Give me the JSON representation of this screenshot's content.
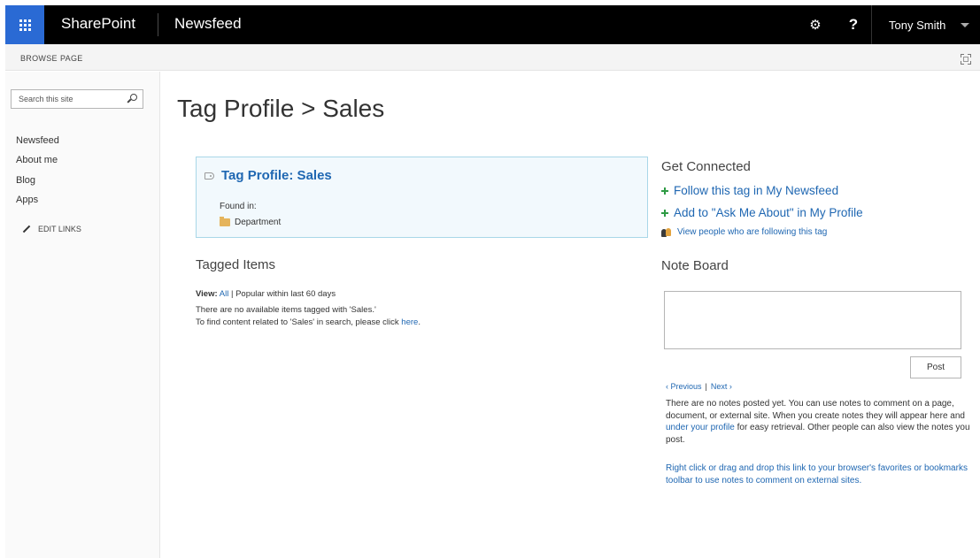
{
  "suite_bar": {
    "brand": "SharePoint",
    "title": "Newsfeed",
    "user_name": "Tony Smith",
    "help_label": "?",
    "gear_glyph": "⚙"
  },
  "ribbon": {
    "tabs": [
      "BROWSE",
      "PAGE"
    ]
  },
  "left_nav": {
    "search_placeholder": "Search this site",
    "items": [
      "Newsfeed",
      "About me",
      "Blog",
      "Apps"
    ],
    "edit_links": "EDIT LINKS"
  },
  "page": {
    "title": "Tag Profile > Sales"
  },
  "tag_box": {
    "title": "Tag Profile: Sales",
    "found_in_label": "Found in:",
    "department": "Department"
  },
  "tagged_items": {
    "heading": "Tagged Items",
    "view_label": "View:",
    "view_all": "All",
    "view_sep": " | ",
    "view_popular": "Popular within last 60 days",
    "message": "There are no available items tagged with 'Sales.'",
    "search_prefix": "To find content related to 'Sales' in search, please click ",
    "search_link": "here",
    "search_suffix": "."
  },
  "get_connected": {
    "heading": "Get Connected",
    "follow_link": "Follow this tag in My Newsfeed",
    "ask_me_link": "Add to \"Ask Me About\" in My Profile",
    "people_link": "View people who are following this tag"
  },
  "note_board": {
    "heading": "Note Board",
    "post_button": "Post",
    "previous": "‹ Previous",
    "next": "Next ›",
    "pager_sep": "|",
    "message_part1": "There are no notes posted yet. You can use notes to comment on a page, document, or external site. When you create notes they will appear here and ",
    "profile_link": "under your profile",
    "message_part2": " for easy retrieval. Other people can also view the notes you post.",
    "bookmark_link": "Right click or drag and drop this link to your browser's favorites or bookmarks toolbar to use notes to comment on external sites."
  },
  "colors": {
    "accent_blue": "#2a6ad4",
    "link_blue": "#1f67b2",
    "suite_bar_bg": "#000000",
    "tag_box_border": "#a9d7e8",
    "plus_green": "#2f9b45"
  },
  "icons": {
    "app_launcher": "waffle-icon",
    "settings": "gear-icon",
    "help": "help-icon",
    "user_menu": "caret-down-icon",
    "focus": "focus-on-content-icon",
    "search": "search-icon",
    "edit": "pencil-icon",
    "tag": "tag-icon",
    "folder": "folder-icon",
    "follow": "plus-icon",
    "people": "people-icon"
  }
}
